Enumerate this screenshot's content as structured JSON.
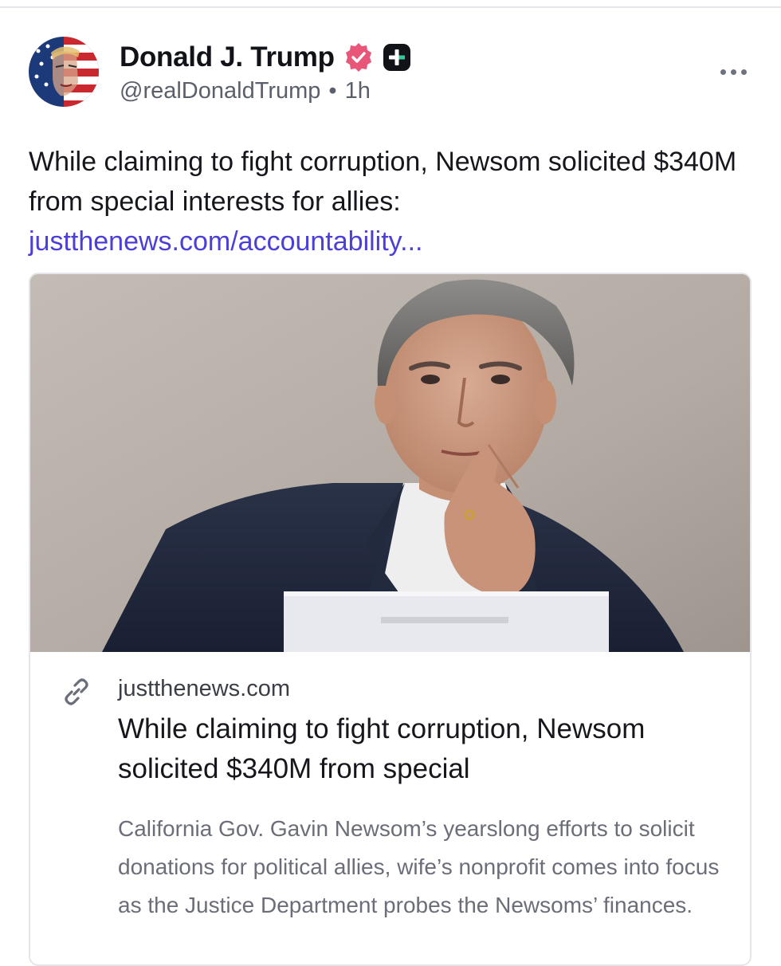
{
  "author": {
    "display_name": "Donald J. Trump",
    "handle": "@realDonaldTrump",
    "separator": "•",
    "time": "1h",
    "icons": [
      "verified-icon",
      "plus-badge-icon",
      "more-icon"
    ],
    "verified_color": "#e8567a"
  },
  "post": {
    "text": "While claiming to fight corruption, Newsom solicited $340M from special interests for allies:",
    "link_text": "justthenews.com/accountability...",
    "link_color": "#4b3fd8"
  },
  "card": {
    "domain": "justthenews.com",
    "title": "While claiming to fight corruption, Newsom solicited $340M from special",
    "description": "California Gov. Gavin Newsom’s yearslong efforts to solicit donations for political allies, wife’s nonprofit comes into focus as the Justice Department probes the Newsoms’ finances."
  }
}
